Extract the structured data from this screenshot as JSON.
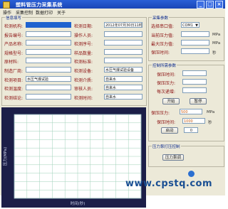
{
  "app": {
    "title": "塑料管压力采集系统"
  },
  "window": {
    "minimize": "_",
    "maximize": "□",
    "close": "×"
  },
  "menu": [
    "操作",
    "采集控制",
    "数据打印",
    "关于"
  ],
  "left_group": {
    "legend": "信息填写",
    "rows": [
      {
        "l1": "检测机构:",
        "v1": "",
        "l2": "检测日期:",
        "v2": "2012年07月30日11时06分"
      },
      {
        "l1": "报告编号:",
        "v1": "",
        "l2": "操作人员:",
        "v2": ""
      },
      {
        "l1": "产品名称:",
        "v1": "",
        "l2": "检测序号:",
        "v2": ""
      },
      {
        "l1": "规格型号:",
        "v1": "",
        "l2": "样品数量:",
        "v2": ""
      },
      {
        "l1": "原材料:",
        "v1": "",
        "l2": "检测标准:",
        "v2": ""
      },
      {
        "l1": "制造厂商:",
        "v1": "",
        "l2": "检测设备:",
        "v2": "水压气爆试验设备"
      },
      {
        "l1": "检测项目:",
        "v1": "水压气爆试验",
        "l2": "检测介质:",
        "v2": "自来水"
      },
      {
        "l1": "检测温度:",
        "v1": "",
        "l2": "审核人员:",
        "v2": "自来水"
      },
      {
        "l1": "检测结论:",
        "v1": "",
        "l2": "检测时间:",
        "v2": "自来水"
      }
    ]
  },
  "right_group": {
    "legend": "采集参数",
    "port_label": "选择串口值:",
    "port_value": "COM1",
    "params": [
      {
        "label": "当前压力值:",
        "value": "",
        "unit": "MPa"
      },
      {
        "label": "最大压力值:",
        "value": "",
        "unit": "MPa"
      },
      {
        "label": "保压时间:",
        "value": "",
        "unit": "秒"
      }
    ]
  },
  "record_group": {
    "legend": "控制所需参数",
    "rows": [
      {
        "label": "保压时间:",
        "value": ""
      },
      {
        "label": "保压压力:",
        "value": ""
      },
      {
        "label": "每次递增:",
        "value": ""
      }
    ],
    "start_button": "开始",
    "stop_button": "暂停",
    "pressure_label": "保压压力:",
    "pressure_value": "500",
    "pressure_unit": "MPa",
    "time_label": "保压时间:",
    "time_value": "1000",
    "time_unit": "秒",
    "auto_button": "启动",
    "auto_value": "0"
  },
  "bottom_group": {
    "legend": "压力泵打压控制",
    "button": "压力泵调"
  },
  "chart_data": {
    "type": "line",
    "title": "",
    "xlabel": "时间(秒)",
    "ylabel": "压力(MPa)",
    "x": [
      0,
      60,
      120,
      180,
      240,
      300,
      360,
      420,
      480,
      540,
      600
    ],
    "xlim": [
      0,
      600
    ],
    "ylim": [
      0,
      10
    ],
    "grid": true,
    "series": []
  },
  "watermark": "www.cpstq.com"
}
